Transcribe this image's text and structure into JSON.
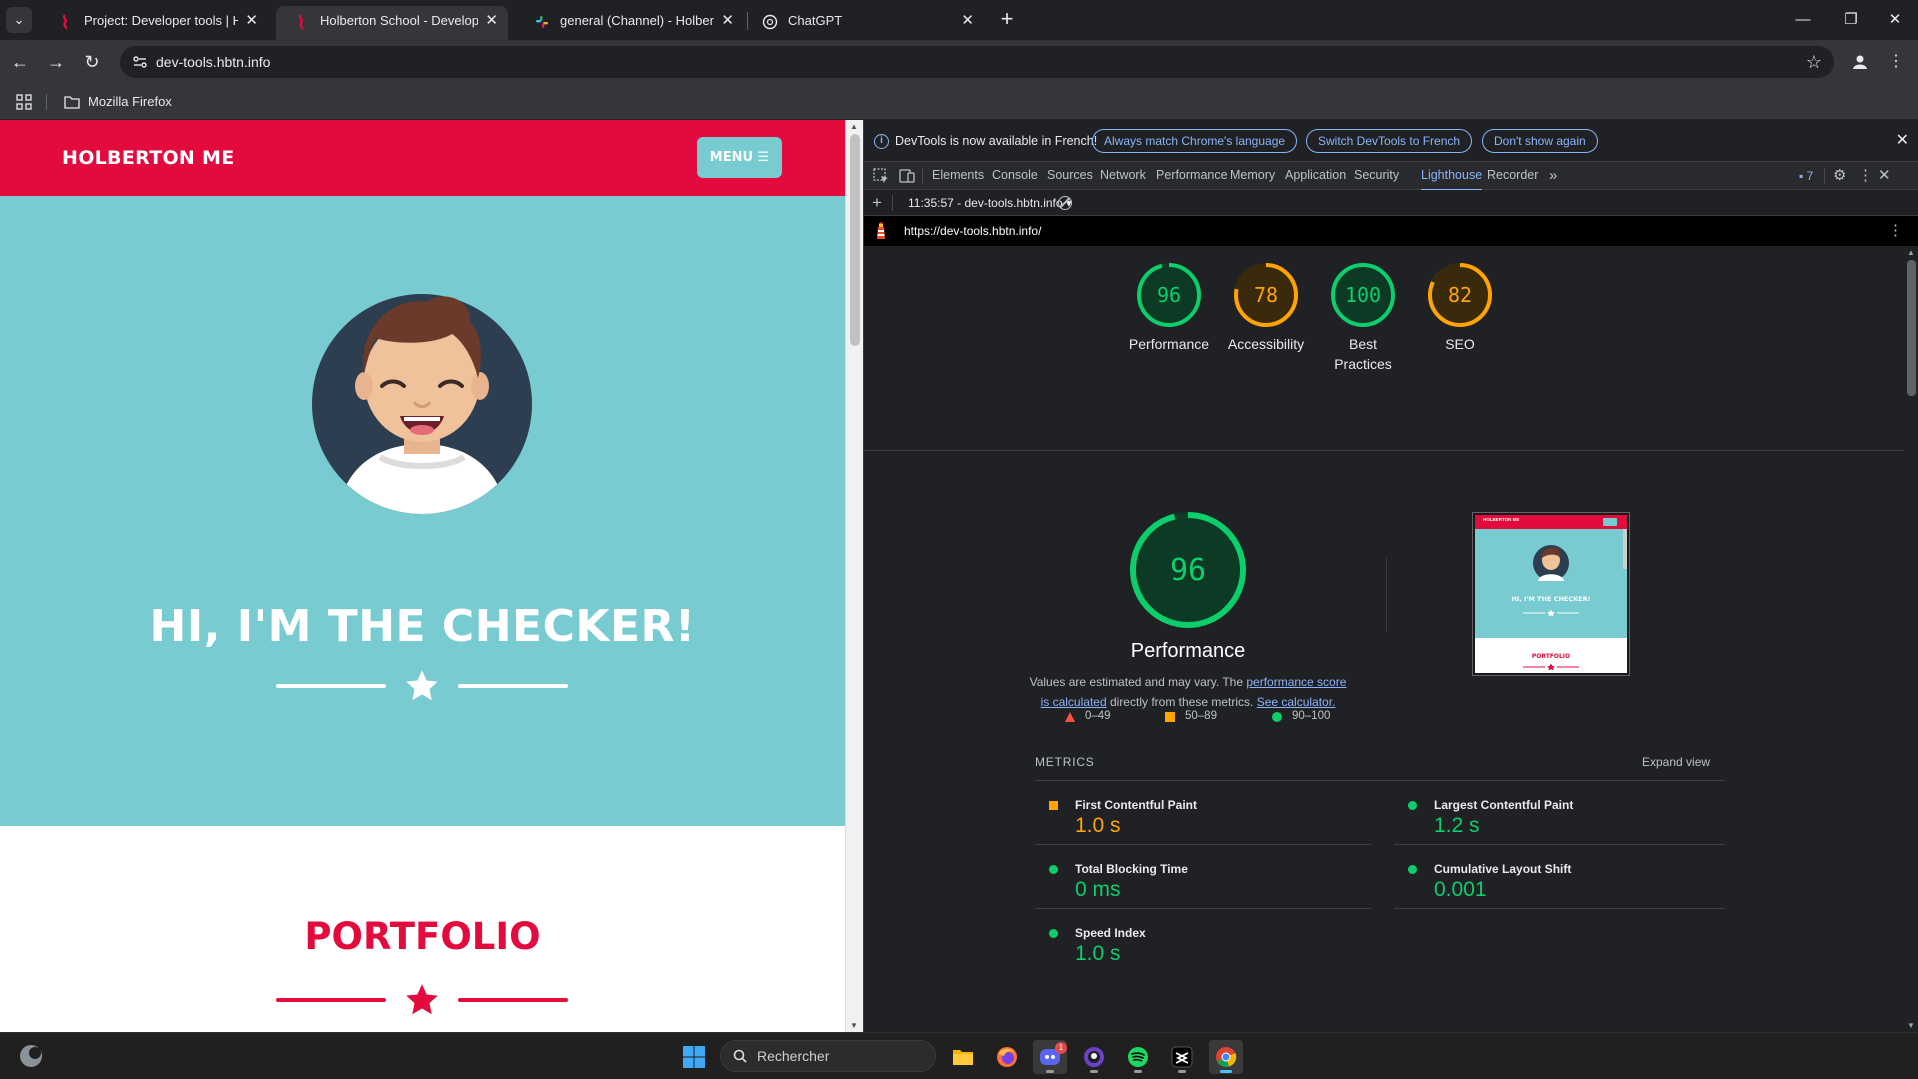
{
  "browser": {
    "tabs": [
      {
        "title": "Project: Developer tools | Holberton",
        "active": false
      },
      {
        "title": "Holberton School - Developer tools",
        "active": true
      },
      {
        "title": "general (Channel) - Holberton School",
        "active": false
      },
      {
        "title": "ChatGPT",
        "active": false
      }
    ],
    "url": "dev-tools.hbtn.info",
    "bookmark_folder": "Mozilla Firefox"
  },
  "site": {
    "brand": "HOLBERTON ME",
    "menu_label": "MENU ☰",
    "hero_title": "HI, I'M THE CHECKER!",
    "portfolio_title": "PORTFOLIO",
    "colors": {
      "primary": "#e30a3d",
      "teal": "#78cbd0"
    }
  },
  "devtools": {
    "infobar": {
      "message": "DevTools is now available in French!",
      "buttons": [
        "Always match Chrome's language",
        "Switch DevTools to French",
        "Don't show again"
      ]
    },
    "tabs": [
      "Elements",
      "Console",
      "Sources",
      "Network",
      "Performance",
      "Memory",
      "Application",
      "Security",
      "Lighthouse",
      "Recorder"
    ],
    "active_tab": "Lighthouse",
    "issues_count": "7",
    "report_selector": "11:35:57 - dev-tools.hbtn.info",
    "report_url": "https://dev-tools.hbtn.info/"
  },
  "lighthouse": {
    "scores": [
      {
        "label": "Performance",
        "score": 96,
        "rating": "pass"
      },
      {
        "label": "Accessibility",
        "score": 78,
        "rating": "average"
      },
      {
        "label": "Best Practices",
        "score": 100,
        "rating": "pass"
      },
      {
        "label": "SEO",
        "score": 82,
        "rating": "average"
      }
    ],
    "performance": {
      "score": 96,
      "title": "Performance",
      "desc_prefix": "Values are estimated and may vary. The ",
      "desc_link1": "performance score is calculated",
      "desc_middle": " directly from these metrics. ",
      "desc_link2": "See calculator."
    },
    "legend": [
      {
        "range": "0–49",
        "color": "#ff4e42",
        "shape": "triangle"
      },
      {
        "range": "50–89",
        "color": "#ffa400",
        "shape": "square"
      },
      {
        "range": "90–100",
        "color": "#0cce6b",
        "shape": "circle"
      }
    ],
    "thumbnail": {
      "brand": "HOLBERTON ME",
      "title": "HI, I'M THE CHECKER!",
      "section": "PORTFOLIO"
    },
    "metrics_heading": "METRICS",
    "expand_label": "Expand view",
    "metrics": [
      {
        "name": "First Contentful Paint",
        "value": "1.0 s",
        "rating": "average"
      },
      {
        "name": "Largest Contentful Paint",
        "value": "1.2 s",
        "rating": "pass"
      },
      {
        "name": "Total Blocking Time",
        "value": "0 ms",
        "rating": "pass"
      },
      {
        "name": "Cumulative Layout Shift",
        "value": "0.001",
        "rating": "pass"
      },
      {
        "name": "Speed Index",
        "value": "1.0 s",
        "rating": "pass"
      }
    ],
    "colors": {
      "pass": "#0cce6b",
      "average": "#ffa400",
      "fail": "#ff4e42"
    }
  },
  "taskbar": {
    "search_placeholder": "Rechercher",
    "apps": [
      "file-explorer",
      "firefox",
      "discord",
      "github-desktop",
      "spotify",
      "capcut",
      "chrome"
    ],
    "discord_badge": "1"
  }
}
